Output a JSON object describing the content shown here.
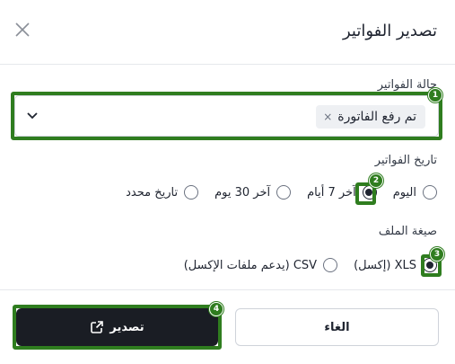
{
  "dialog": {
    "title": "تصدير الفواتير",
    "close_icon": "close-icon"
  },
  "status": {
    "label": "حالة الفواتير",
    "selected_chip": "تم رفع الفاتورة",
    "chip_remove": "×"
  },
  "date": {
    "label": "تاريخ الفواتير",
    "options": [
      {
        "label": "اليوم",
        "checked": false
      },
      {
        "label": "آخر 7 أيام",
        "checked": true
      },
      {
        "label": "آخر 30 يوم",
        "checked": false
      },
      {
        "label": "تاريخ محدد",
        "checked": false
      }
    ]
  },
  "format": {
    "label": "صيغة الملف",
    "options": [
      {
        "label": "XLS (إكسل)",
        "checked": true
      },
      {
        "label": "CSV (يدعم ملفات الإكسل)",
        "checked": false
      }
    ]
  },
  "footer": {
    "cancel_label": "الغاء",
    "export_label": "تصدير"
  },
  "annotations": {
    "badge_1": "1",
    "badge_2": "2",
    "badge_3": "3",
    "badge_4": "4"
  },
  "colors": {
    "highlight": "#2f7d1f",
    "primary_button": "#1a1d24"
  }
}
